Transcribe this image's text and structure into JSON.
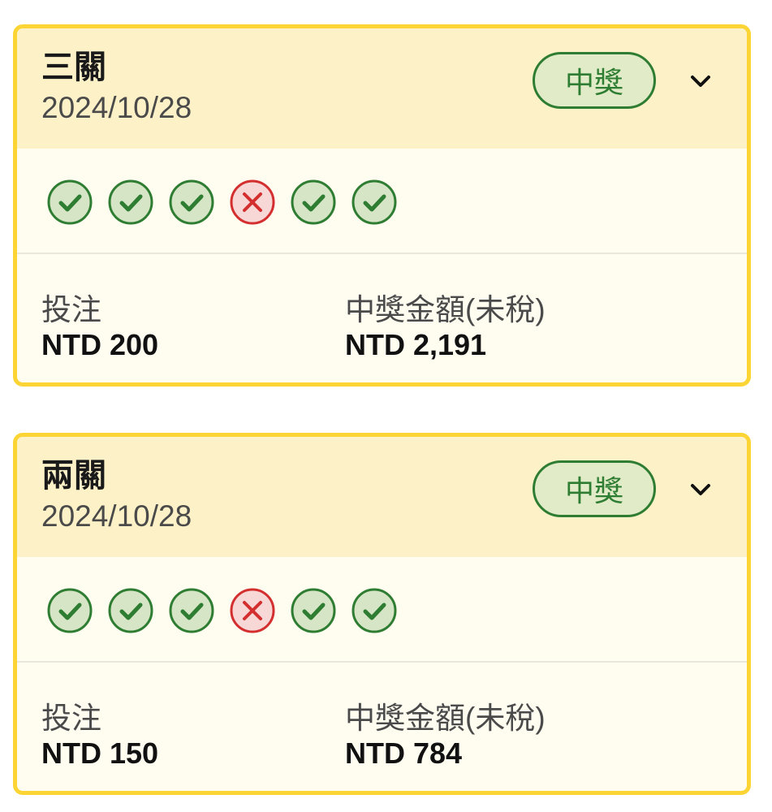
{
  "colors": {
    "border": "#fcd535",
    "header_bg": "#fdf1c7",
    "body_bg": "#fffcf0",
    "win_green": "#2e7d32",
    "win_green_fill": "#d6e5c5",
    "lose_red": "#d32f2f",
    "lose_red_fill": "#f8d7d7"
  },
  "cards": [
    {
      "title": "三關",
      "date": "2024/10/28",
      "status": "中獎",
      "results": [
        "check",
        "check",
        "check",
        "cross",
        "check",
        "check"
      ],
      "stake_label": "投注",
      "stake_value": "NTD 200",
      "payout_label": "中獎金額(未稅)",
      "payout_value": "NTD 2,191"
    },
    {
      "title": "兩關",
      "date": "2024/10/28",
      "status": "中獎",
      "results": [
        "check",
        "check",
        "check",
        "cross",
        "check",
        "check"
      ],
      "stake_label": "投注",
      "stake_value": "NTD 150",
      "payout_label": "中獎金額(未稅)",
      "payout_value": "NTD 784"
    }
  ]
}
